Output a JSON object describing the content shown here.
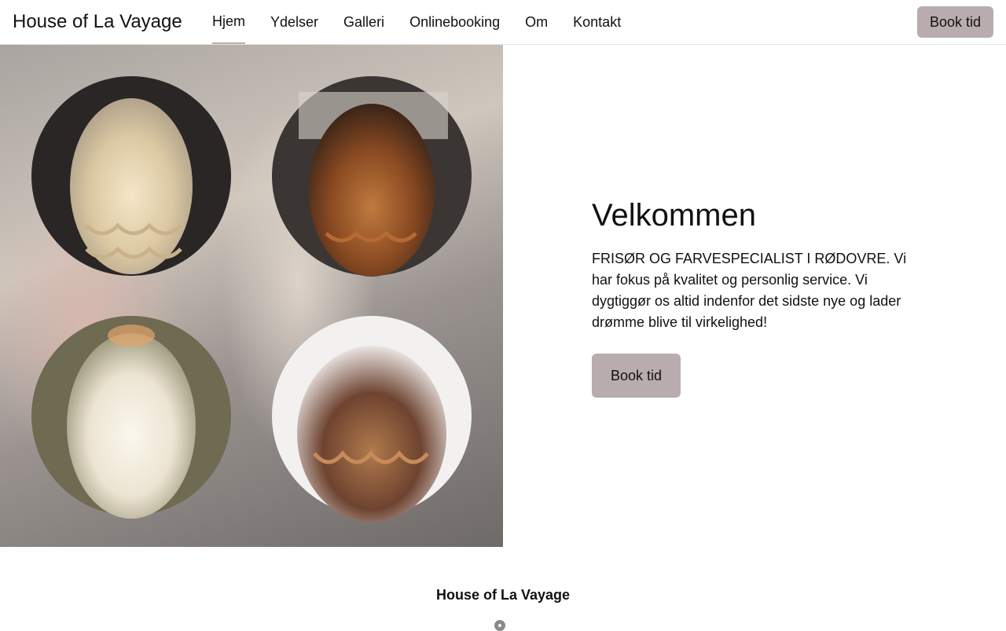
{
  "header": {
    "brand": "House of La Vayage",
    "nav": [
      {
        "label": "Hjem",
        "active": true
      },
      {
        "label": "Ydelser",
        "active": false
      },
      {
        "label": "Galleri",
        "active": false
      },
      {
        "label": "Onlinebooking",
        "active": false
      },
      {
        "label": "Om",
        "active": false
      },
      {
        "label": "Kontakt",
        "active": false
      }
    ],
    "book_label": "Book tid"
  },
  "hero": {
    "heading": "Velkommen",
    "text": "FRISØR OG FARVESPECIALIST I RØDOVRE. Vi har fokus på kvalitet og personlig service. Vi dygtiggør os altid indenfor det sidste nye og lader drømme blive til virkelighed!",
    "book_label": "Book tid"
  },
  "footer": {
    "title": "House of La Vayage",
    "icon": "map-pin-icon"
  },
  "colors": {
    "accent": "#b9acae",
    "text": "#111111",
    "border": "#e6e6e6"
  }
}
